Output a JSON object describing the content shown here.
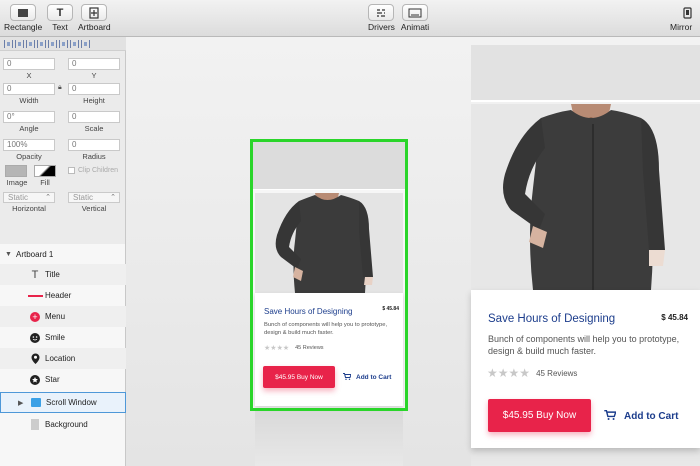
{
  "toolbar": {
    "rectangle": "Rectangle",
    "text": "Text",
    "artboard": "Artboard",
    "drivers": "Drivers",
    "animate": "Animati",
    "mirror": "Mirror"
  },
  "inspector": {
    "x_value": "0",
    "x_label": "X",
    "y_value": "0",
    "y_label": "Y",
    "width_value": "0",
    "width_label": "Width",
    "height_value": "0",
    "height_label": "Height",
    "angle_value": "0°",
    "angle_label": "Angle",
    "scale_value": "0",
    "scale_label": "Scale",
    "opacity_value": "100%",
    "opacity_label": "Opacity",
    "radius_value": "0",
    "radius_label": "Radius",
    "image_label": "Image",
    "fill_label": "Fill",
    "clip_children_label": "Clip Children",
    "horizontal_value": "Static",
    "horizontal_label": "Horizontal",
    "vertical_value": "Static",
    "vertical_label": "Vertical"
  },
  "layers": {
    "artboard": "Artboard 1",
    "items": [
      {
        "name": "Title",
        "icon": "text-icon"
      },
      {
        "name": "Header",
        "icon": "line-icon"
      },
      {
        "name": "Menu",
        "icon": "plus-circle-icon"
      },
      {
        "name": "Smile",
        "icon": "smile-icon"
      },
      {
        "name": "Location",
        "icon": "location-icon"
      },
      {
        "name": "Star",
        "icon": "star-icon"
      },
      {
        "name": "Scroll Window",
        "icon": "folder-icon"
      },
      {
        "name": "Background",
        "icon": "rectangle-icon"
      }
    ]
  },
  "product": {
    "title": "Save Hours of Designing",
    "price": "$ 45.84",
    "description": "Bunch of components will help you to prototype, design & build much faster.",
    "reviews": "45 Reviews",
    "rating": 0,
    "buy_label": "$45.95 Buy Now",
    "cart_label": "Add to Cart"
  },
  "colors": {
    "accent": "#e8234a",
    "title": "#1c3d8c",
    "selection": "#2ad52a"
  }
}
